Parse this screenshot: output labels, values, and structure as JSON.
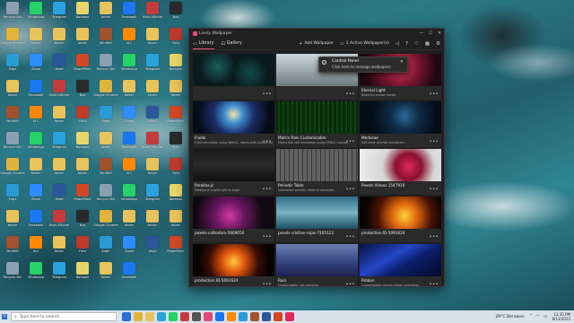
{
  "window": {
    "title": "Lively Wallpaper",
    "controls": [
      "—",
      "☐",
      "✕"
    ]
  },
  "nav": {
    "tabs": [
      {
        "label": "Library",
        "icon": "library-icon"
      },
      {
        "label": "Gallery",
        "icon": "gallery-icon"
      }
    ],
    "add_label": "Add Wallpaper",
    "active_label": "1 Active Wallpaper(s)"
  },
  "toast": {
    "title": "Control Panel",
    "message": "Click here to manage wallpapers"
  },
  "tiles": [
    {
      "name": "",
      "desc": "",
      "thumb": "th-particles"
    },
    {
      "name": "",
      "desc": "",
      "thumb": "th-cloud"
    },
    {
      "name": "Eternal Light",
      "desc": "Beautiful sunset render.",
      "thumb": "th-eternal"
    },
    {
      "name": "Fluids",
      "desc": "Fluid simulation using WebGL, reacts with system audio & cursor.",
      "thumb": "th-fluids"
    },
    {
      "name": "Matrix Rain Customizable",
      "desc": "Matrix like rain animation using HTML5 Canvas.",
      "thumb": "th-matrix"
    },
    {
      "name": "Medusae",
      "desc": "Soft body jellyfish simulation.",
      "thumb": "th-medusae"
    },
    {
      "name": "Parallax.js",
      "desc": "Parallax.js engine github page.",
      "thumb": "th-parallax"
    },
    {
      "name": "Periodic Table",
      "desc": "Interactive periodic table of elements.",
      "thumb": "th-periodic"
    },
    {
      "name": "Pexels Videos 1547910",
      "desc": "",
      "thumb": "th-pexels"
    },
    {
      "name": "pexels-cottonbro-5669050",
      "desc": "",
      "thumb": "th-cotton"
    },
    {
      "name": "pexels-cristian-rojas-7105122",
      "desc": "",
      "thumb": "th-waves"
    },
    {
      "name": "production ID-5091624",
      "desc": "",
      "thumb": "th-fire"
    },
    {
      "name": "production ID-5091624",
      "desc": "",
      "thumb": "th-fire2"
    },
    {
      "name": "Rain",
      "desc": "Customizable rain particles.",
      "thumb": "th-rain"
    },
    {
      "name": "Ribbon",
      "desc": "Customizable canvas ribbon animation.",
      "thumb": "th-ribbon"
    }
  ],
  "desktop_icons": [
    {
      "label": "Recycle Bin",
      "color": "#8aa0b0"
    },
    {
      "label": "WhatsApp",
      "color": "#25d366"
    },
    {
      "label": "Telegram",
      "color": "#2aa3dd"
    },
    {
      "label": "Notepad",
      "color": "#e8d56a"
    },
    {
      "label": "folder",
      "color": "#e8c25a"
    },
    {
      "label": "Facebook",
      "color": "#1877f2"
    },
    {
      "label": "Multi-MDrive",
      "color": "#c43b3b"
    },
    {
      "label": "Nox",
      "color": "#2a2a2a"
    },
    {
      "label": "Google Chrome",
      "color": "#e0b43a"
    },
    {
      "label": "folder",
      "color": "#e8c25a"
    },
    {
      "label": "folder",
      "color": "#e8c25a"
    },
    {
      "label": "folder",
      "color": "#e8c25a"
    },
    {
      "label": "WinRAR",
      "color": "#a0522d"
    },
    {
      "label": "VLC",
      "color": "#ff8800"
    },
    {
      "label": "folder",
      "color": "#e8c25a"
    },
    {
      "label": "Foto",
      "color": "#c0392b"
    },
    {
      "label": "Edge",
      "color": "#2b9bd6"
    },
    {
      "label": "Zoom",
      "color": "#2d8cff"
    },
    {
      "label": "Word",
      "color": "#2b579a"
    },
    {
      "label": "PowerPoint",
      "color": "#d24726"
    }
  ],
  "taskbar": {
    "search_placeholder": "Type here to search",
    "weather": "29°C Berawan",
    "time": "12:35 PM",
    "date": "8/13/2022",
    "apps": [
      "#2b6ed6",
      "#e0b43a",
      "#e8c25a",
      "#2aa3dd",
      "#25d366",
      "#c43b3b",
      "#555555",
      "#e04a7a",
      "#1877f2",
      "#ff8800",
      "#2b9bd6",
      "#a0522d",
      "#2b579a",
      "#d24726",
      "#e0285a"
    ]
  }
}
